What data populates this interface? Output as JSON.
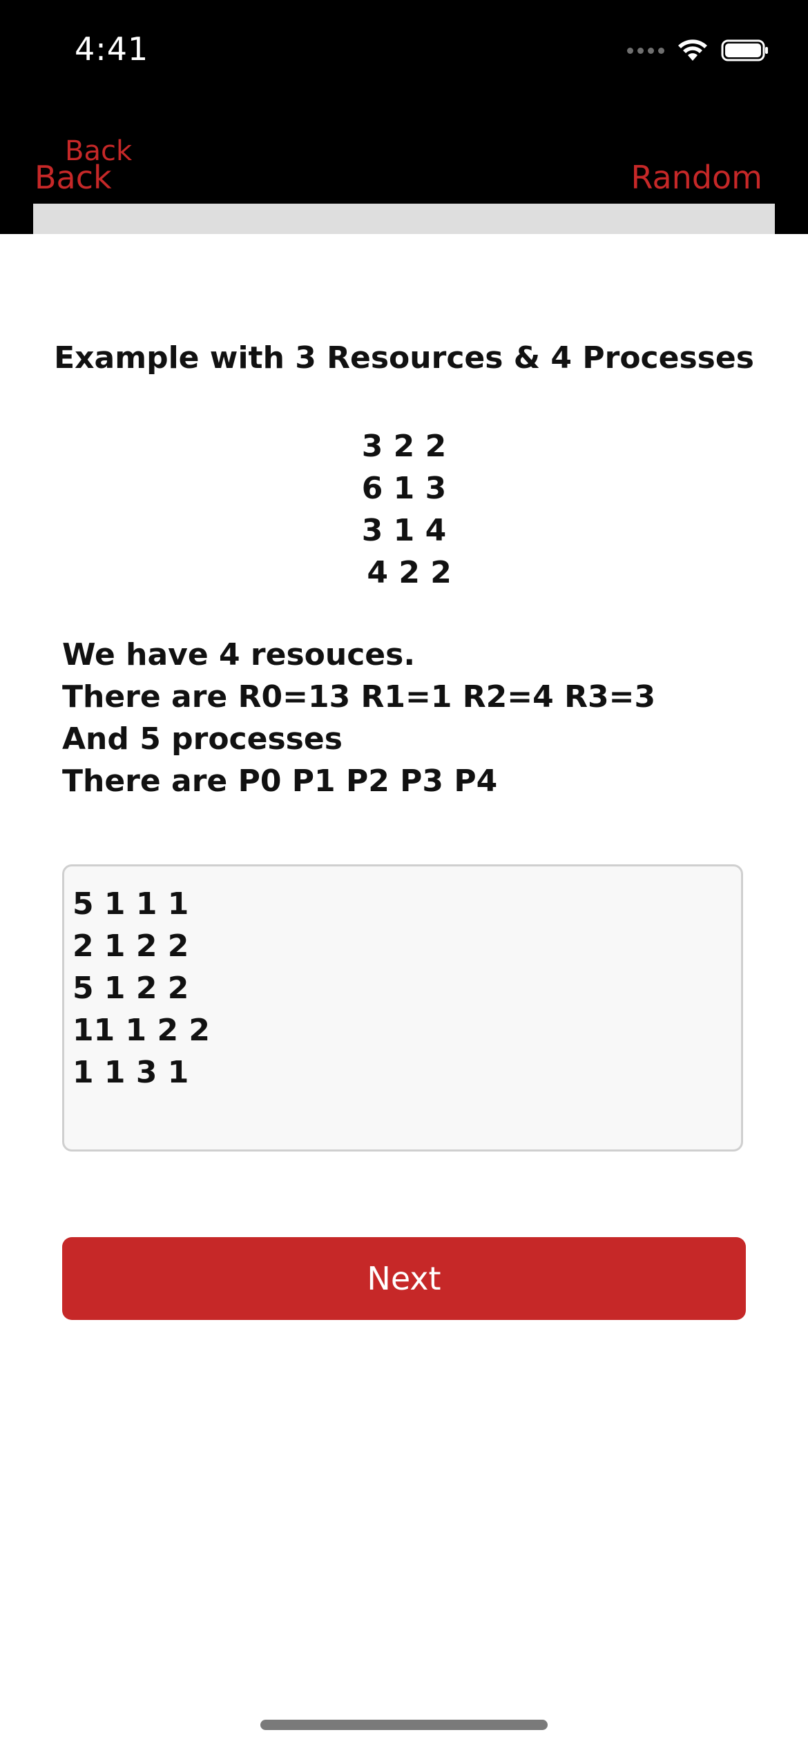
{
  "status_bar": {
    "time": "4:41",
    "wifi_icon": "wifi-icon",
    "battery_icon": "battery-icon"
  },
  "nav": {
    "back_small": "Back",
    "back": "Back",
    "random": "Random"
  },
  "content": {
    "title": "Example with 3 Resources & 4 Processes",
    "matrix_rows": [
      "3 2 2",
      "6 1 3",
      "3 1 4",
      " 4 2 2"
    ],
    "info_lines": [
      "We have 4 resouces.",
      "There are R0=13 R1=1 R2=4 R3=3",
      "And 5 processes",
      "There are P0 P1 P2 P3 P4"
    ],
    "input_lines": [
      "5 1 1 1",
      "2 1 2 2",
      "5 1 2 2",
      "11 1 2 2",
      "1 1 3 1"
    ],
    "next_label": "Next"
  },
  "colors": {
    "accent": "#c62828",
    "header_bg": "#000000",
    "strip": "#dedede"
  }
}
